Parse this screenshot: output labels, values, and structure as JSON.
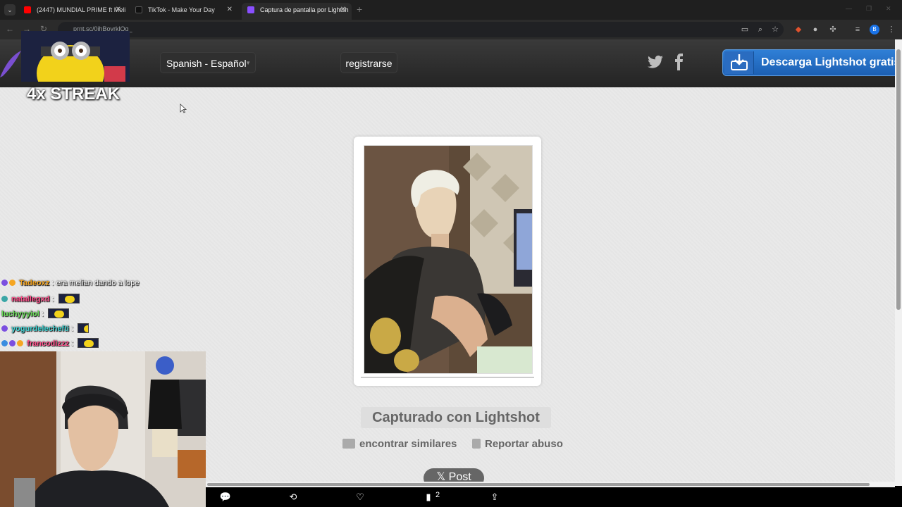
{
  "browser": {
    "tabs": [
      {
        "title": "(2447) MUNDIAL PRIME ft Meli",
        "favicon_color": "#ff0000"
      },
      {
        "title": "TikTok - Make Your Day",
        "favicon_color": "#000000"
      },
      {
        "title": "Captura de pantalla por Lightsh",
        "favicon_color": "#8a4fff"
      }
    ],
    "url": "prnt.sc/0jhBoyrklQg_"
  },
  "site": {
    "language_selector": "Spanish - Español",
    "register_label": "registrarse",
    "download_label": "Descarga Lightshot gratis",
    "captured_label": "Capturado con Lightshot",
    "find_similar_label": "encontrar similares",
    "report_label": "Reportar abuso",
    "post_label": "Post"
  },
  "overlay": {
    "streak_text": "4x STREAK",
    "chat": [
      {
        "user": "Tadeoxz",
        "user_color": "#f5a623",
        "message": ": era melian dando a lope",
        "emote": false
      },
      {
        "user": "natallegxd",
        "user_color": "#ff4f8b",
        "message": ":",
        "emote": true
      },
      {
        "user": "luchyyyiol",
        "user_color": "#6be05a",
        "message": ":",
        "emote": true
      },
      {
        "user": "yogurdelechefti",
        "user_color": "#45d7d7",
        "message": ":",
        "emote": true
      },
      {
        "user": "francodizzz",
        "user_color": "#ff4f8b",
        "message": ":",
        "emote": true
      }
    ]
  },
  "social_bar": {
    "views_count": "2"
  }
}
